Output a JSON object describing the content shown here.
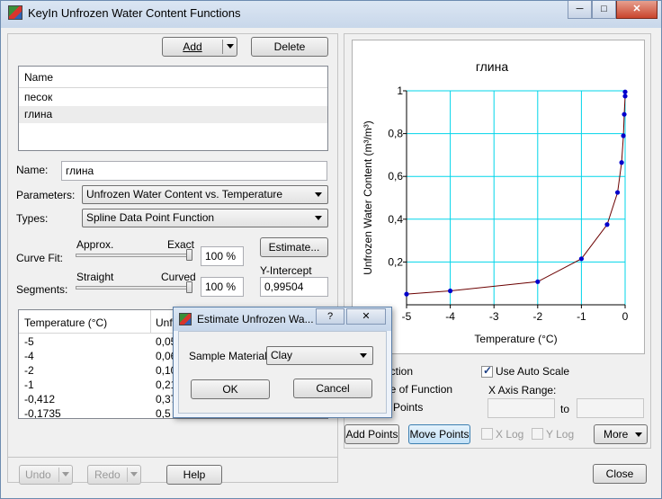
{
  "window": {
    "title": "KeyIn Unfrozen Water Content Functions"
  },
  "toolbar": {
    "add_label": "Add",
    "delete_label": "Delete"
  },
  "materials": {
    "header": "Name",
    "items": [
      {
        "name": "песок"
      },
      {
        "name": "глина"
      }
    ],
    "selected": "глина"
  },
  "form": {
    "name_label": "Name:",
    "name_value": "глина",
    "parameters_label": "Parameters:",
    "parameters_value": "Unfrozen Water Content vs. Temperature",
    "types_label": "Types:",
    "types_value": "Spline Data Point Function",
    "curve_fit_label": "Curve Fit:",
    "curve_fit_left": "Approx.",
    "curve_fit_right": "Exact",
    "curve_fit_value": "100 %",
    "curve_fit_level": 1.0,
    "segments_label": "Segments:",
    "segments_left": "Straight",
    "segments_right": "Curved",
    "segments_value": "100 %",
    "segments_level": 1.0,
    "estimate_label": "Estimate...",
    "y_intercept_label": "Y-Intercept",
    "y_intercept_value": "0,99504"
  },
  "table": {
    "col_temperature": "Temperature (°C)",
    "col_unfrozen": "Unf",
    "rows": [
      {
        "t": "-5",
        "u": "0,05"
      },
      {
        "t": "-4",
        "u": "0,06"
      },
      {
        "t": "-2",
        "u": "0,10"
      },
      {
        "t": "-1",
        "u": "0,21"
      },
      {
        "t": "-0,412",
        "u": "0,37"
      },
      {
        "t": "-0,1735",
        "u": "0,5"
      }
    ]
  },
  "bottom": {
    "undo_label": "Undo",
    "redo_label": "Redo",
    "help_label": "Help",
    "close_label": "Close"
  },
  "options": {
    "function_partial": "nction",
    "slope_partial": "pe of Function",
    "points_partial": "a Points",
    "auto_scale_label": "Use Auto Scale",
    "auto_scale_checked": true,
    "x_axis_range_label": "X Axis Range:",
    "to_label": "to",
    "add_points_label": "Add Points",
    "move_points_label": "Move Points",
    "xlog_label": "X Log",
    "ylog_label": "Y Log",
    "more_label": "More"
  },
  "dialog": {
    "title": "Estimate Unfrozen Wa...",
    "help_glyph": "?",
    "close_glyph": "✕",
    "sample_label": "Sample Material:",
    "sample_value": "Clay",
    "ok_label": "OK",
    "cancel_label": "Cancel"
  },
  "chart_data": {
    "type": "line",
    "title": "глина",
    "xlabel": "Temperature (°C)",
    "ylabel": "Unfrozen Water Content (m³/m³)",
    "xlim": [
      -5,
      0
    ],
    "ylim": [
      0,
      1
    ],
    "xticks": [
      "-5",
      "-4",
      "-3",
      "-2",
      "-1",
      "0"
    ],
    "yticks": [
      "0,2",
      "0,4",
      "0,6",
      "0,8",
      "1"
    ],
    "grid": true,
    "grid_color": "#00d5ea",
    "line_color": "#6b0000",
    "point_color": "#0000cc",
    "points": [
      {
        "x": -5,
        "y": 0.05
      },
      {
        "x": -4,
        "y": 0.065
      },
      {
        "x": -2,
        "y": 0.108
      },
      {
        "x": -1,
        "y": 0.215
      },
      {
        "x": -0.412,
        "y": 0.375
      },
      {
        "x": -0.1735,
        "y": 0.525
      },
      {
        "x": -0.08,
        "y": 0.665
      },
      {
        "x": -0.04,
        "y": 0.79
      },
      {
        "x": -0.02,
        "y": 0.89
      },
      {
        "x": 0,
        "y": 0.975
      },
      {
        "x": 0,
        "y": 0.995
      }
    ]
  }
}
